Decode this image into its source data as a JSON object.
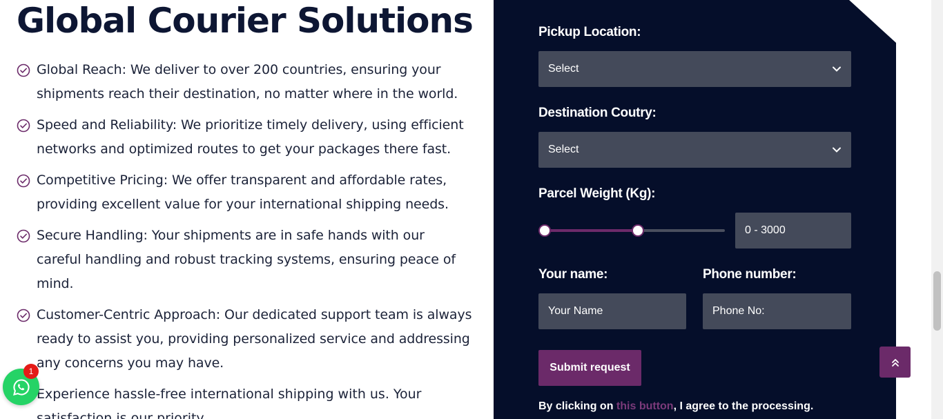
{
  "heading": "Global Courier Solutions",
  "features": [
    "Global Reach: We deliver to over 200 countries, ensuring your shipments reach their destination, no matter where in the world.",
    "Speed and Reliability: We prioritize timely delivery, using efficient networks and optimized routes to get your packages there fast.",
    "Competitive Pricing: We offer transparent and affordable rates, providing excellent value for your international shipping needs.",
    "Secure Handling: Your shipments are in safe hands with our careful handling and robust tracking systems, ensuring peace of mind.",
    "Customer-Centric Approach: Our dedicated support team is always ready to assist you, providing personalized service and addressing any concerns you may have."
  ],
  "closing": "Experience hassle-free international shipping with us. Your satisfaction is our priority.",
  "whatsapp": {
    "badge_count": "1",
    "icon": "whatsapp-icon",
    "color": "#25d366",
    "badge_color": "#e41b17"
  },
  "form": {
    "pickup_label": "Pickup Location:",
    "pickup_value": "Select",
    "destination_label": "Destination Coutry:",
    "destination_value": "Select",
    "weight_label": "Parcel Weight (Kg):",
    "weight_range": "0 - 3000",
    "weight_min_fraction": 0.0,
    "weight_max_fraction": 0.52,
    "name_label": "Your name:",
    "name_placeholder": "Your Name",
    "phone_label": "Phone number:",
    "phone_placeholder": "Phone No:",
    "submit_label": "Submit request",
    "consent_prefix": "By clicking on ",
    "consent_link": "this button",
    "consent_suffix": ", I agree to the processing."
  },
  "colors": {
    "panel_bg": "#050e2a",
    "accent": "#6b2a69",
    "field_bg": "#444a5a",
    "heading": "#0d1633",
    "check": "#6b2a69"
  },
  "icons": {
    "check": "check-circle-icon",
    "chevron": "chevron-down-icon",
    "scroll_top": "double-chevron-up-icon"
  }
}
